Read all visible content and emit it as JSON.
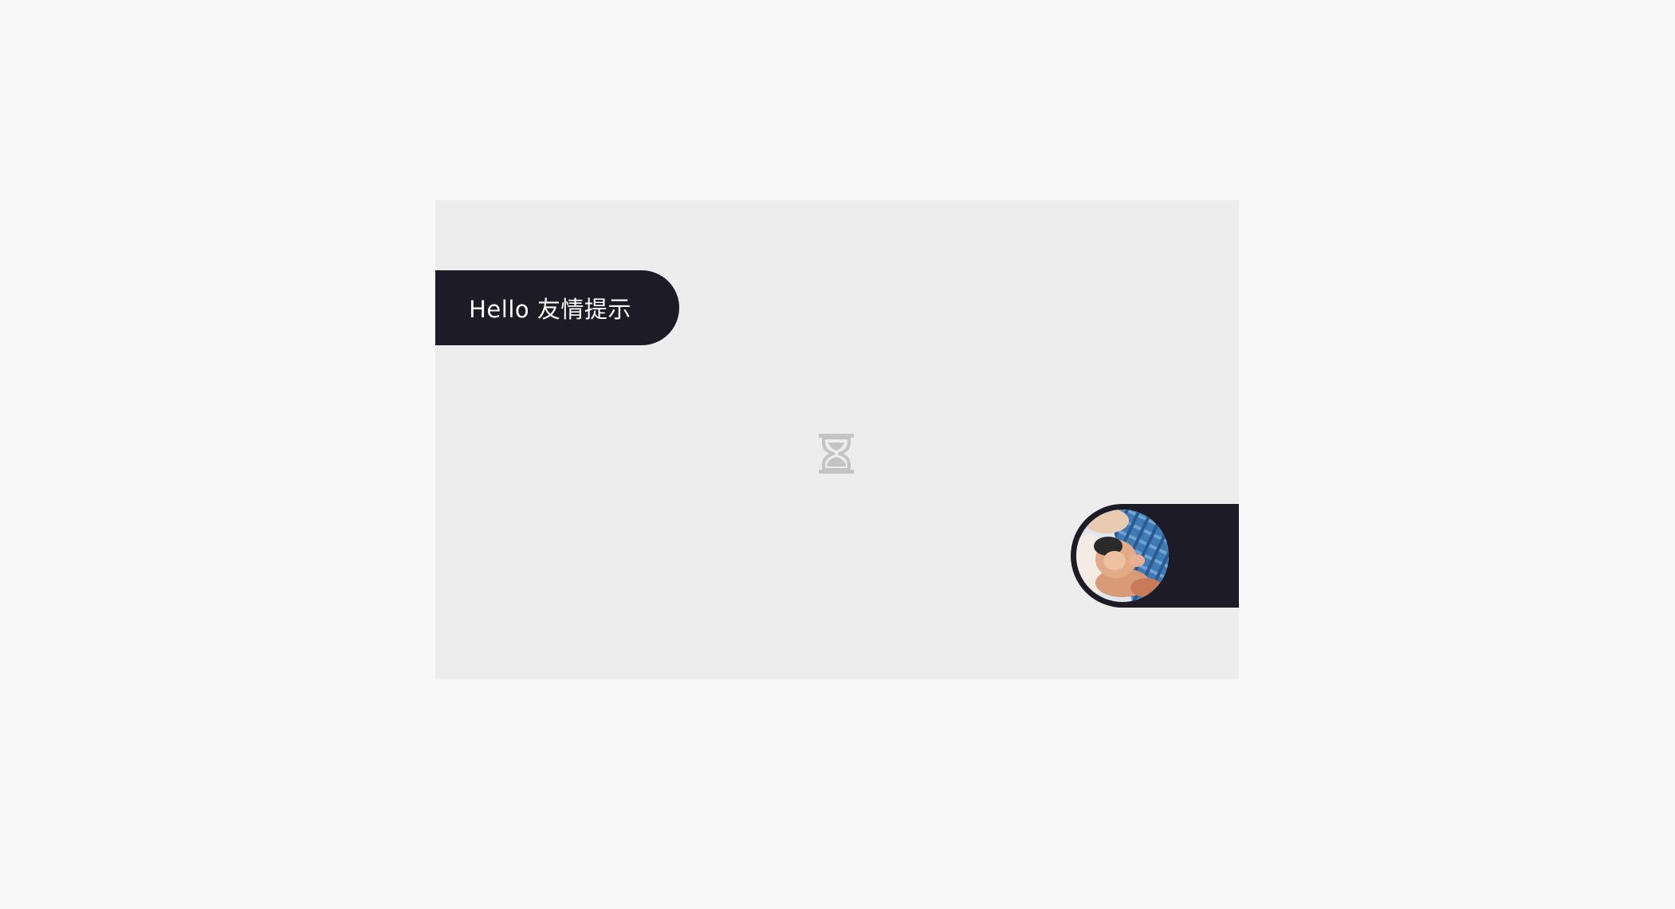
{
  "tip": {
    "text": "Hello 友情提示"
  },
  "loading": {
    "icon": "hourglass-icon"
  },
  "avatar": {
    "icon": "baby-photo-avatar"
  },
  "colors": {
    "page_background": "#f8f8f8",
    "stage_background": "#ededed",
    "bubble_dark": "#1c1b26",
    "icon_gray": "#c4c4c4"
  }
}
